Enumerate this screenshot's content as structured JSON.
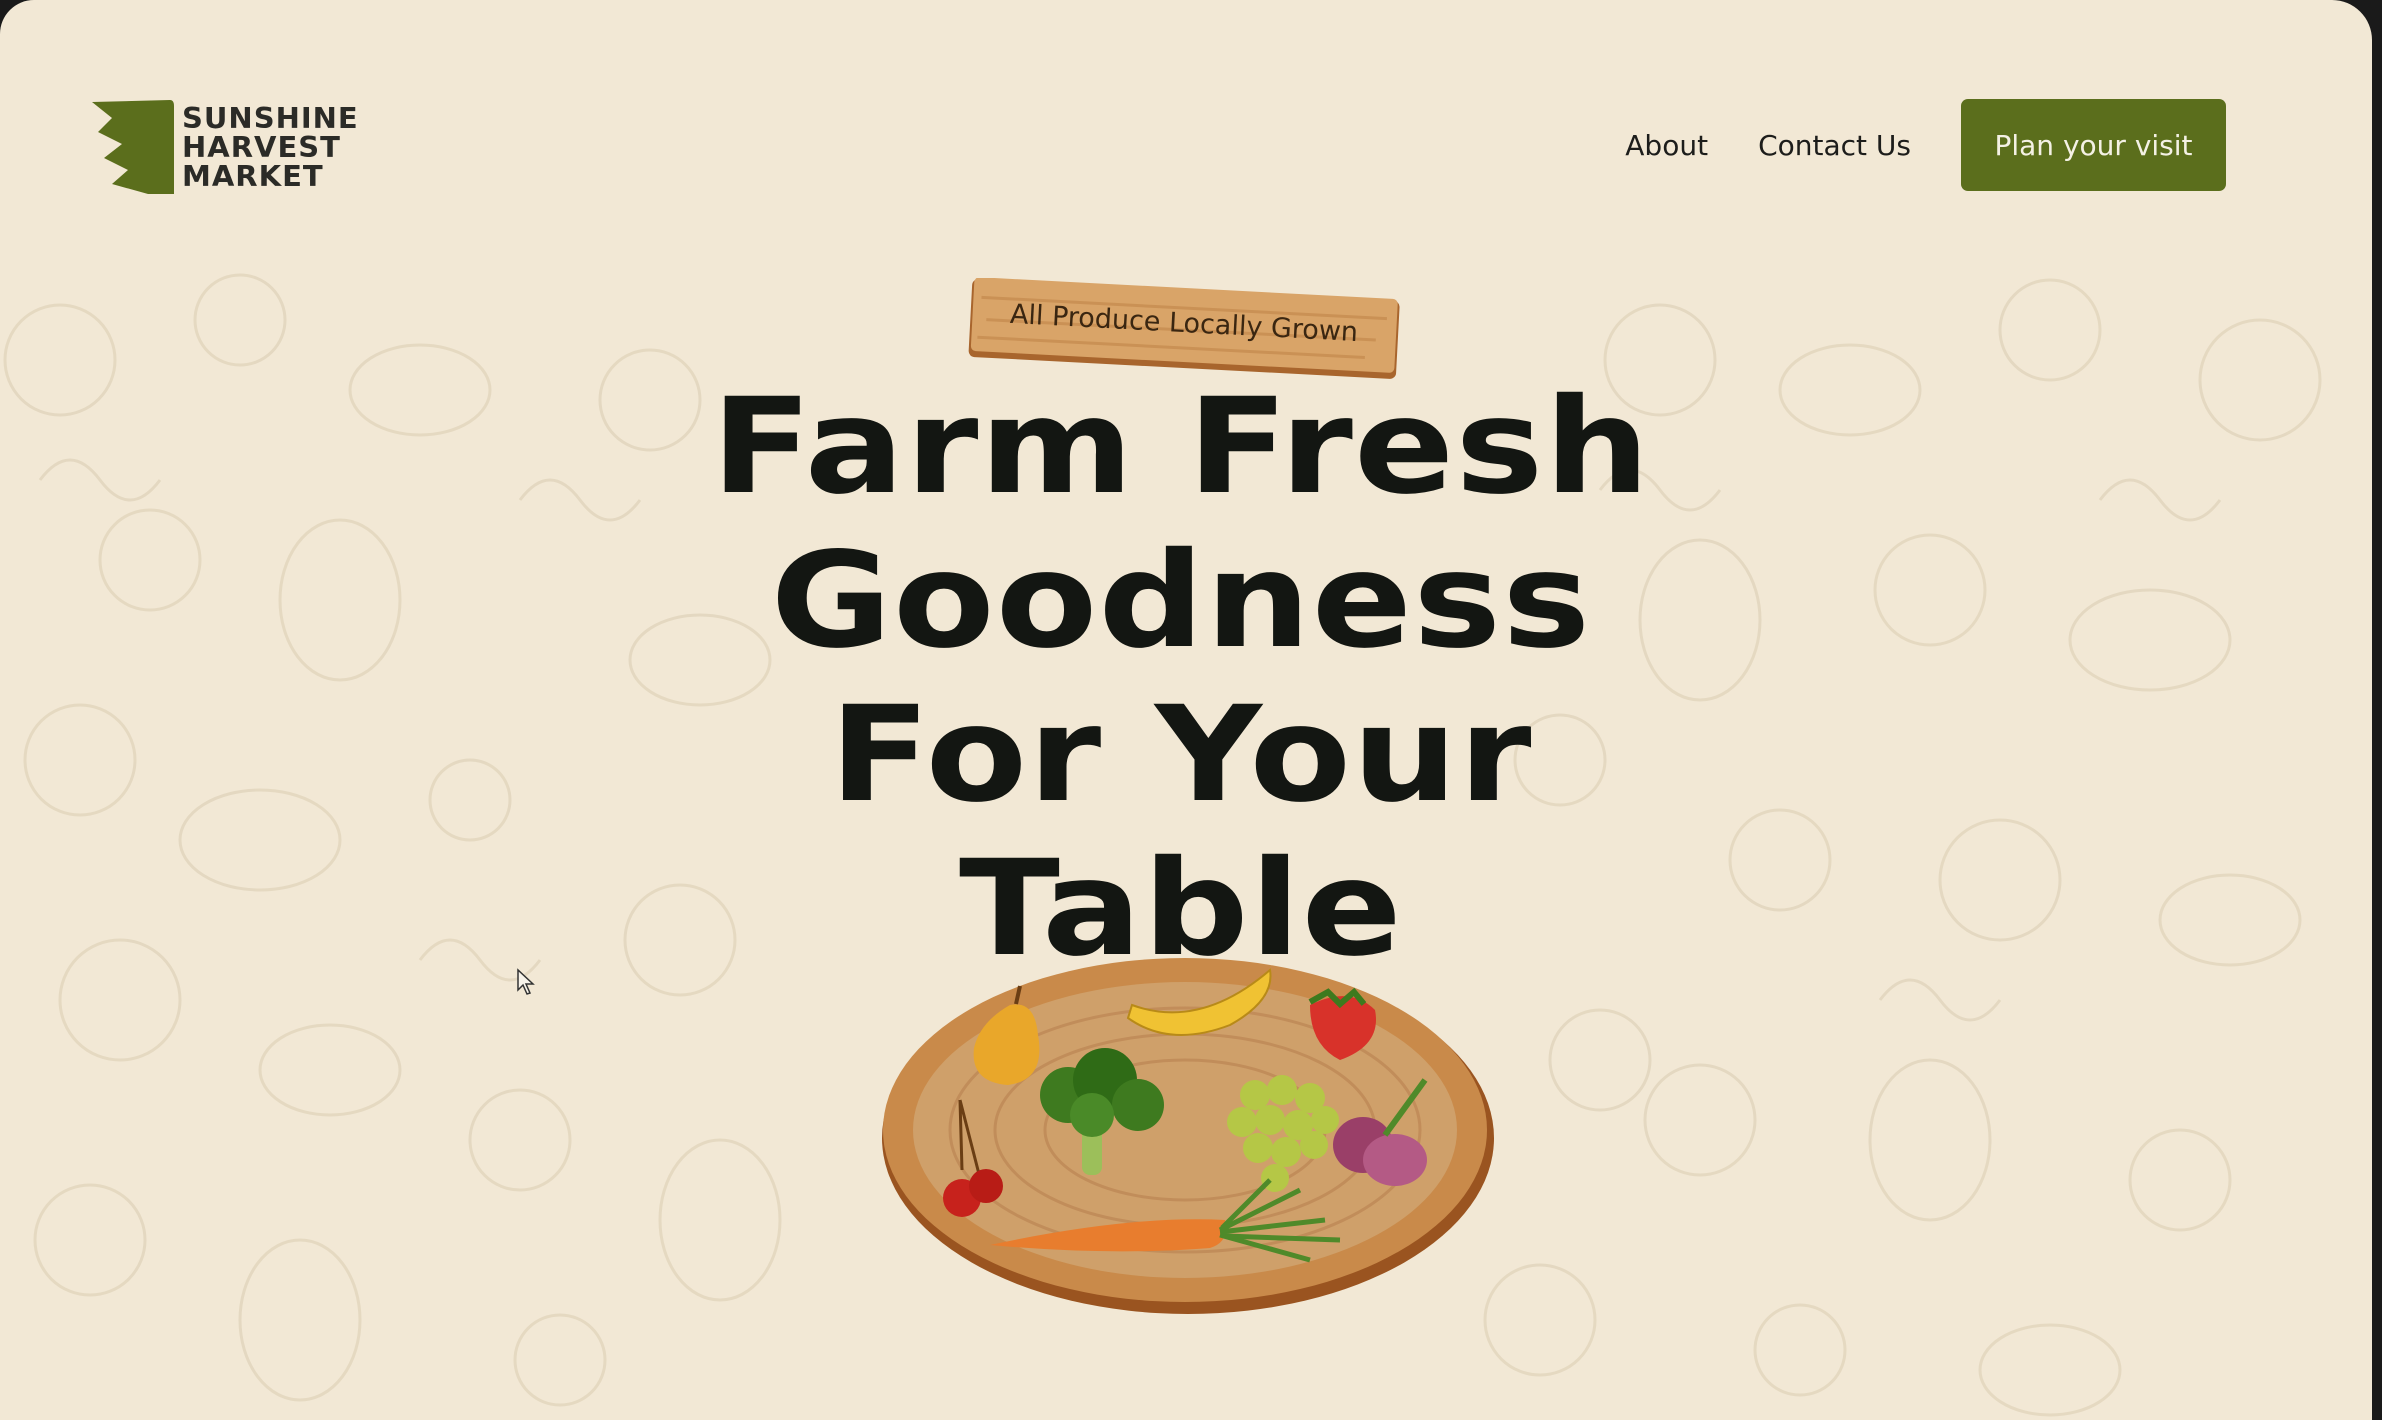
{
  "header": {
    "logo_lines": [
      "SUNSHINE",
      "HARVEST",
      "MARKET"
    ],
    "nav": {
      "about": "About",
      "contact": "Contact Us"
    },
    "cta": "Plan your visit"
  },
  "hero": {
    "badge": "All Produce Locally Grown",
    "headline_lines": [
      "Farm Fresh",
      "Goodness",
      "For Your",
      "Table"
    ],
    "board_produce": [
      "pear",
      "banana",
      "strawberry",
      "broccoli",
      "grapes",
      "onion",
      "cherries",
      "carrot"
    ]
  },
  "colors": {
    "background": "#f2e8d5",
    "brand_green": "#5b6e1c",
    "headline": "#131612",
    "wood": "#c98a4a"
  },
  "icons": {
    "logo_mark": "zigzag-leaf-icon",
    "cursor": "mouse-pointer-icon"
  }
}
